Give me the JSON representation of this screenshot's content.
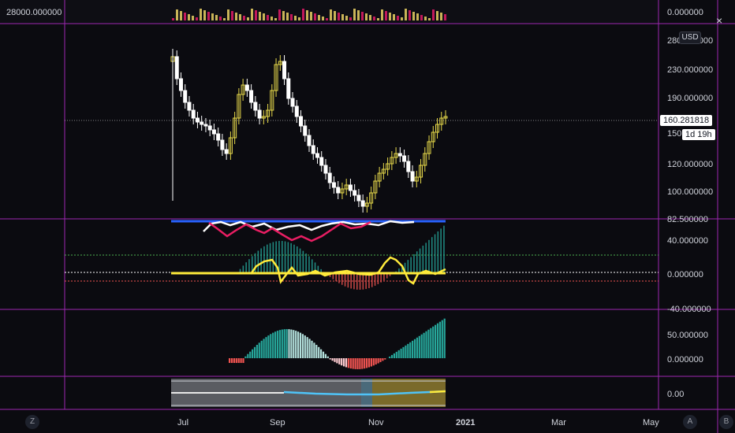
{
  "price_axis": {
    "volume_pane_top": "28000.000000",
    "volume_pane_right": "0.000000",
    "main": [
      "280.000000",
      "230.000000",
      "190.000000",
      "150.000000",
      "120.000000",
      "100.000000",
      "82.500000"
    ],
    "osc1": [
      "40.000000",
      "0.000000",
      "-40.000000"
    ],
    "osc2": [
      "50.000000",
      "0.000000"
    ],
    "osc3": [
      "0.00"
    ]
  },
  "current_price": "160.281818",
  "countdown": "1d 19h",
  "currency": "USD",
  "time_axis": [
    "Jul",
    "Sep",
    "Nov",
    "2021",
    "Mar",
    "May"
  ],
  "buttons": {
    "zoom": "Z",
    "auto": "A",
    "log": "B",
    "close": "×"
  },
  "colors": {
    "background": "#0b0b10",
    "pane_separator": "#9c27b0",
    "candle_bull": "#e6d84a",
    "candle_bear": "#ffffff",
    "hist_green": "#26a69a",
    "hist_red": "#ef5350",
    "line_yellow": "#ffeb3b",
    "line_magenta": "#e91e63",
    "line_blue": "#2962ff"
  },
  "chart_data": {
    "type": "candlestick",
    "x_range": [
      "Jun",
      "May"
    ],
    "y_range": [
      82.5,
      280
    ],
    "last_close": 160.281818
  }
}
